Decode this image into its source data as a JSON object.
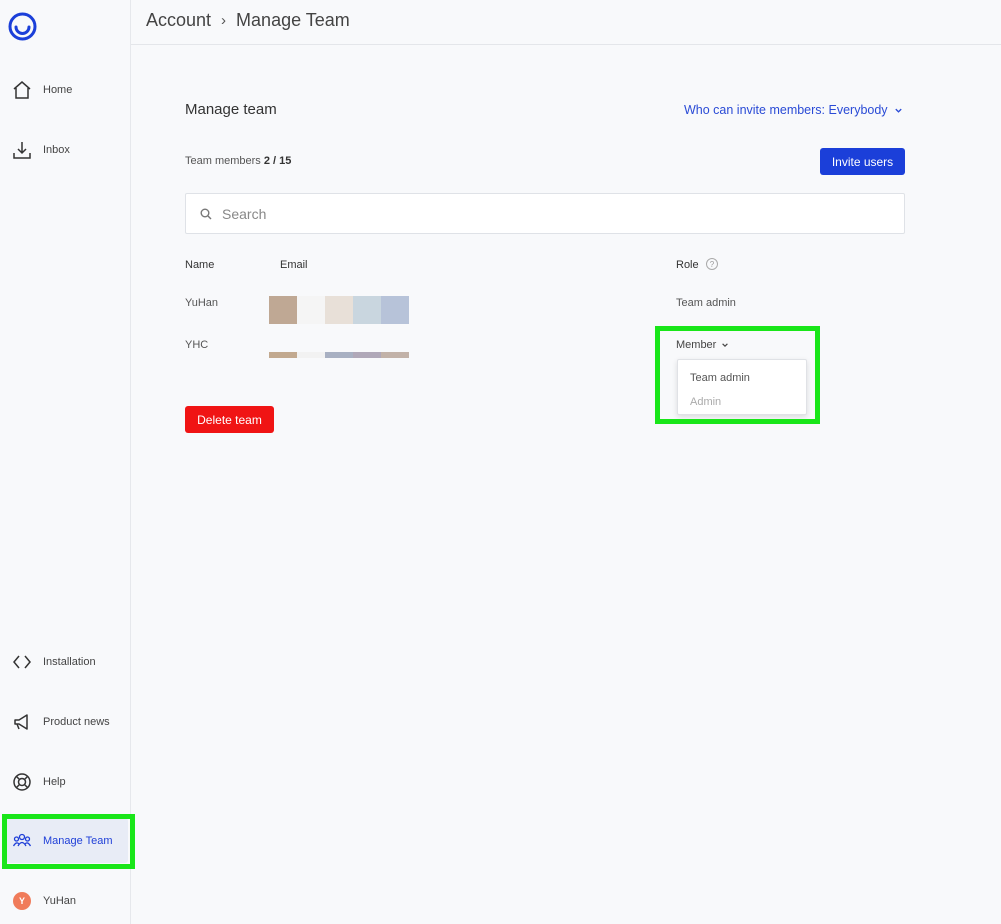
{
  "sidebar": {
    "logo": "app-logo",
    "items": [
      {
        "label": "Home",
        "icon": "home-icon"
      },
      {
        "label": "Inbox",
        "icon": "inbox-download-icon"
      },
      {
        "label": "Installation",
        "icon": "code-brackets-icon"
      },
      {
        "label": "Product news",
        "icon": "megaphone-icon"
      },
      {
        "label": "Help",
        "icon": "lifebuoy-icon"
      },
      {
        "label": "Manage Team",
        "icon": "team-icon",
        "active": true
      }
    ],
    "user": {
      "initial": "Y",
      "name": "YuHan"
    }
  },
  "breadcrumb": {
    "parent": "Account",
    "separator": "›",
    "current": "Manage Team"
  },
  "main": {
    "title": "Manage team",
    "invite_setting": "Who can invite members: Everybody",
    "members_label": "Team members",
    "members_count": "2 / 15",
    "invite_button": "Invite users",
    "search_placeholder": "Search",
    "columns": {
      "name": "Name",
      "email": "Email",
      "role": "Role",
      "role_help": "?"
    },
    "rows": [
      {
        "name": "YuHan",
        "role": "Team admin"
      },
      {
        "name": "YHC",
        "role": "Member"
      }
    ],
    "role_options": [
      "Team admin",
      "Admin"
    ],
    "delete_button": "Delete team"
  },
  "colors": {
    "accent": "#1b3fd9",
    "danger": "#f01414",
    "highlight": "#19e619",
    "link": "#2a4bd6",
    "avatar": "#f07b5a"
  }
}
